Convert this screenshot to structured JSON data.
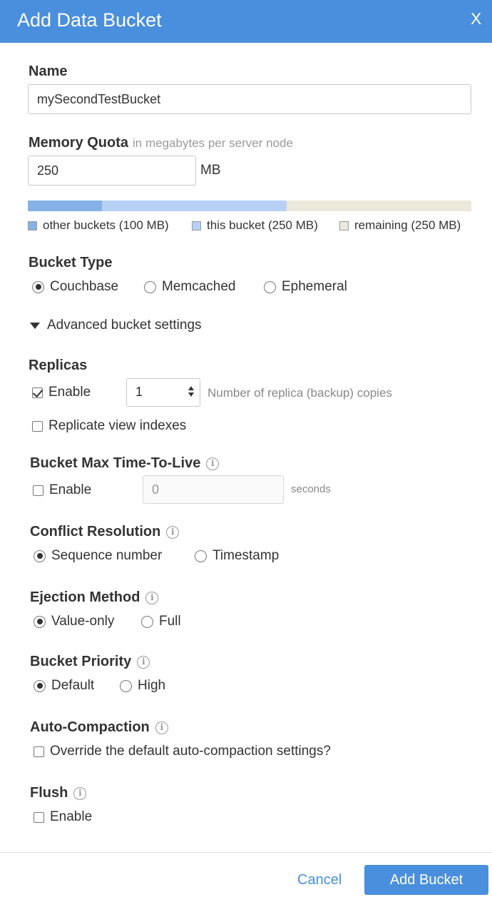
{
  "dialog": {
    "title": "Add Data Bucket",
    "close_label": "X"
  },
  "name": {
    "label": "Name",
    "value": "mySecondTestBucket"
  },
  "memory_quota": {
    "label": "Memory Quota",
    "hint": "in megabytes per server node",
    "value": "250",
    "unit": "MB",
    "usage_mb": {
      "other": 100,
      "this": 250,
      "remaining": 250
    },
    "legend": {
      "other": "other buckets (100 MB)",
      "this": "this bucket (250 MB)",
      "remaining": "remaining (250 MB)"
    },
    "colors": {
      "other": "#86b1e6",
      "this": "#b7d1f4",
      "remaining": "#ede8dc"
    }
  },
  "bucket_type": {
    "label": "Bucket Type",
    "options": [
      "Couchbase",
      "Memcached",
      "Ephemeral"
    ],
    "selected": "Couchbase"
  },
  "advanced": {
    "label": "Advanced bucket settings"
  },
  "replicas": {
    "label": "Replicas",
    "enable_label": "Enable",
    "enabled": true,
    "count": "1",
    "count_hint": "Number of replica (backup) copies",
    "replicate_views_label": "Replicate view indexes",
    "replicate_views": false
  },
  "ttl": {
    "label": "Bucket Max Time-To-Live",
    "enable_label": "Enable",
    "enabled": false,
    "value": "0",
    "unit": "seconds"
  },
  "conflict": {
    "label": "Conflict Resolution",
    "options": [
      "Sequence number",
      "Timestamp"
    ],
    "selected": "Sequence number"
  },
  "ejection": {
    "label": "Ejection Method",
    "options": [
      "Value-only",
      "Full"
    ],
    "selected": "Value-only"
  },
  "priority": {
    "label": "Bucket Priority",
    "options": [
      "Default",
      "High"
    ],
    "selected": "Default"
  },
  "compaction": {
    "label": "Auto-Compaction",
    "override_label": "Override the default auto-compaction settings?",
    "override": false
  },
  "flush": {
    "label": "Flush",
    "enable_label": "Enable",
    "enabled": false
  },
  "footer": {
    "cancel_label": "Cancel",
    "submit_label": "Add Bucket"
  },
  "colors": {
    "accent": "#4a8fdd"
  }
}
